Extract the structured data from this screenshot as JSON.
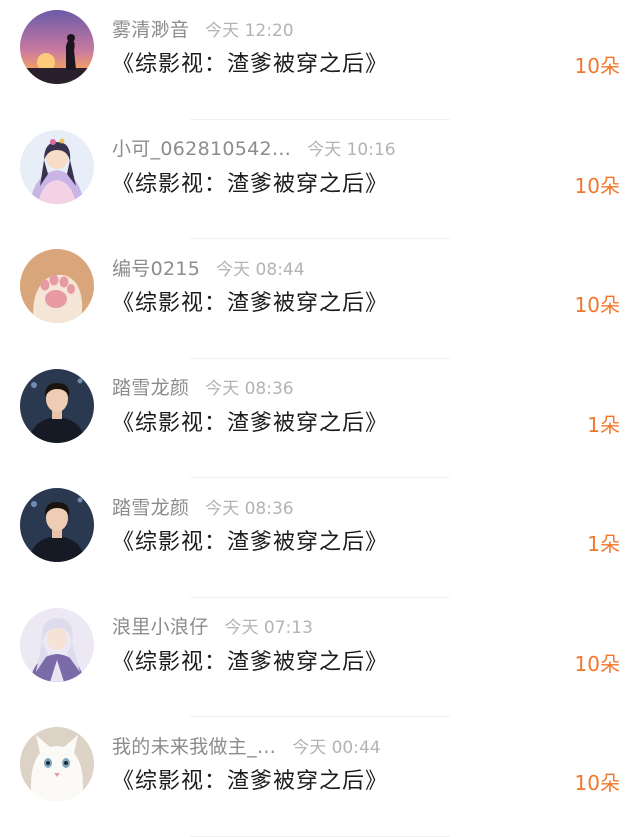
{
  "gift_list": {
    "items": [
      {
        "username": "雾清渺音",
        "time": "今天 12:20",
        "book": "《综影视：渣爹被穿之后》",
        "count": "10朵",
        "avatar_icon": "sunset-silhouette-avatar"
      },
      {
        "username": "小可_062810542…",
        "time": "今天 10:16",
        "book": "《综影视：渣爹被穿之后》",
        "count": "10朵",
        "avatar_icon": "anime-girl-avatar"
      },
      {
        "username": "编号0215",
        "time": "今天 08:44",
        "book": "《综影视：渣爹被穿之后》",
        "count": "10朵",
        "avatar_icon": "cat-paw-avatar"
      },
      {
        "username": "踏雪龙颜",
        "time": "今天 08:36",
        "book": "《综影视：渣爹被穿之后》",
        "count": "1朵",
        "avatar_icon": "man-portrait-avatar"
      },
      {
        "username": "踏雪龙颜",
        "time": "今天 08:36",
        "book": "《综影视：渣爹被穿之后》",
        "count": "1朵",
        "avatar_icon": "man-portrait-avatar"
      },
      {
        "username": "浪里小浪仔",
        "time": "今天 07:13",
        "book": "《综影视：渣爹被穿之后》",
        "count": "10朵",
        "avatar_icon": "anime-silver-hair-avatar"
      },
      {
        "username": "我的未来我做主_…",
        "time": "今天 00:44",
        "book": "《综影视：渣爹被穿之后》",
        "count": "10朵",
        "avatar_icon": "white-cat-avatar"
      }
    ]
  },
  "colors": {
    "count": "#f2772b",
    "username": "#8c8c8c",
    "time": "#b3b3b3",
    "book": "#1c1c1c"
  }
}
